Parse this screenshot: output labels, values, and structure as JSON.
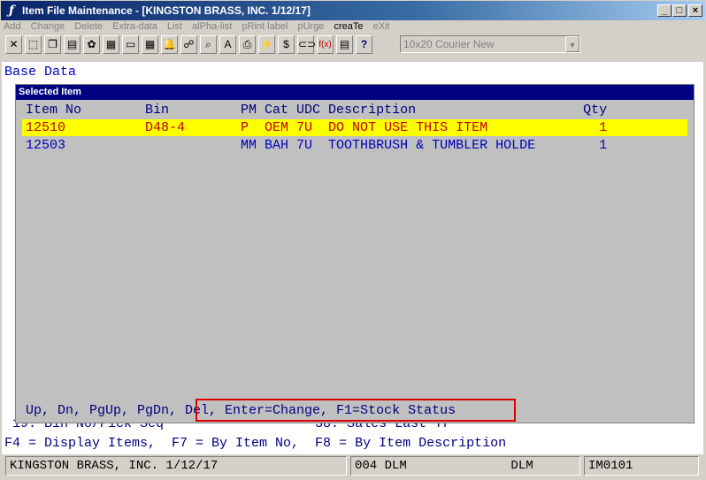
{
  "window": {
    "title": "Item File Maintenance - [KINGSTON BRASS, INC. 1/12/17]",
    "app_icon": "ƒ",
    "min": "_",
    "max": "□",
    "close": "×"
  },
  "menu": [
    {
      "label": "Add"
    },
    {
      "label": "Change"
    },
    {
      "label": "Delete"
    },
    {
      "label": "Extra-data"
    },
    {
      "label": "List"
    },
    {
      "label": "alPha-list"
    },
    {
      "label": "pRint label"
    },
    {
      "label": "pUrge"
    },
    {
      "label": "creaTe"
    },
    {
      "label": "eXit"
    }
  ],
  "toolbar": {
    "icons": [
      "close-x-icon",
      "select-rect-icon",
      "copy-icon",
      "paste-icon",
      "settings-icon",
      "print-preview-icon",
      "notes-icon",
      "calc-icon",
      "bell-icon",
      "binoculars-icon",
      "search-icon",
      "font-a-icon",
      "print-icon",
      "lightning-icon",
      "dollar-icon",
      "link-icon",
      "function-icon",
      "document-icon",
      "help-pointer-icon"
    ],
    "glyphs": [
      "✕",
      "⬚",
      "❐",
      "▤",
      "✿",
      "▦",
      "▭",
      "▦",
      "🔔",
      "☍",
      "⌕",
      "A",
      "⎙",
      "⚡",
      "$",
      "⊂⊃",
      "f(x)",
      "▤",
      "?"
    ],
    "font_select": "10x20 Courier New"
  },
  "terminal": {
    "section_title": "Base Data",
    "panel_title": "Selected Item",
    "headers": "Item No        Bin         PM Cat UDC Description                     Qty",
    "rows": [
      {
        "text": "12510          D48-4       P  OEM 7U  DO NOT USE THIS ITEM              1",
        "selected": true
      },
      {
        "text": "12503                      MM BAH 7U  TOOTHBRUSH & TUMBLER HOLDE        1",
        "selected": false
      }
    ],
    "hint": "Up, Dn, PgUp, PgDn, Del, Enter=Change, F1=Stock Status",
    "underlay_line": "19. Bin No/Pick Seq                   38. Sales Last Yr",
    "function_keys": "F4 = Display Items,  F7 = By Item No,  F8 = By Item Description"
  },
  "status": {
    "company": "KINGSTON BRASS, INC. 1/12/17",
    "user": "004 DLM              DLM",
    "program": "IM0101"
  }
}
